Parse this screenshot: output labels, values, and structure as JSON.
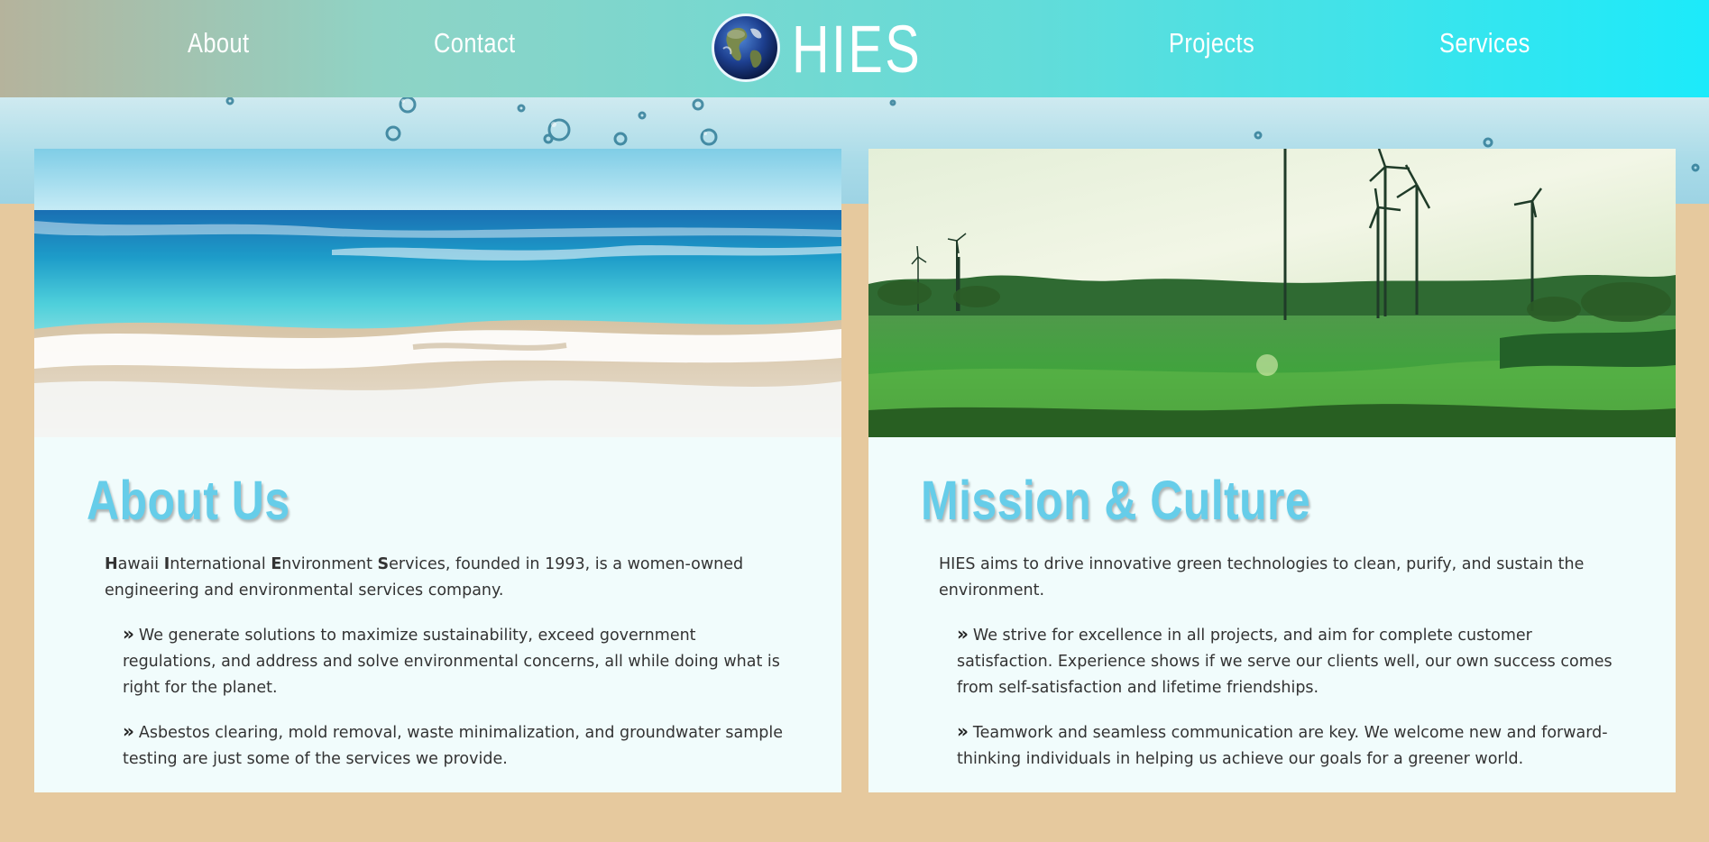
{
  "nav": {
    "about": "About",
    "contact": "Contact",
    "brand": "HIES",
    "projects": "Projects",
    "services": "Services"
  },
  "about_card": {
    "title": "About Us",
    "intro": {
      "h": "H",
      "awaii": "awaii ",
      "i": "I",
      "nternational": "nternational ",
      "e": "E",
      "nvironment": "nvironment ",
      "s": "S",
      "rest": "ervices, founded in 1993, is a women-owned engineering and environmental services company."
    },
    "bullets": [
      "We generate solutions to maximize sustainability, exceed government regulations, and address and solve environmental concerns, all while doing what is right for the planet.",
      "Asbestos clearing, mold removal, waste minimalization, and groundwater sample testing are just some of the services we provide."
    ]
  },
  "mission_card": {
    "title": "Mission & Culture",
    "intro": "HIES aims to drive innovative green technologies to clean, purify, and sustain the environment.",
    "bullets": [
      "We strive for excellence in all projects, and aim for complete customer satisfaction. Experience shows if we serve our clients well, our own success comes from self-satisfaction and lifetime friendships.",
      "Teamwork and seamless communication are key. We welcome new and forward-thinking individuals in helping us achieve our goals for a greener world."
    ]
  },
  "icons": {
    "bullet": "double-chevron-right-icon",
    "logo": "earth-globe-icon"
  },
  "colors": {
    "title": "#66cde9",
    "page_background": "#e6c99e",
    "card_background": "#f1fcfc",
    "nav_start": "#b5b39c",
    "nav_end": "#1ceafa"
  }
}
